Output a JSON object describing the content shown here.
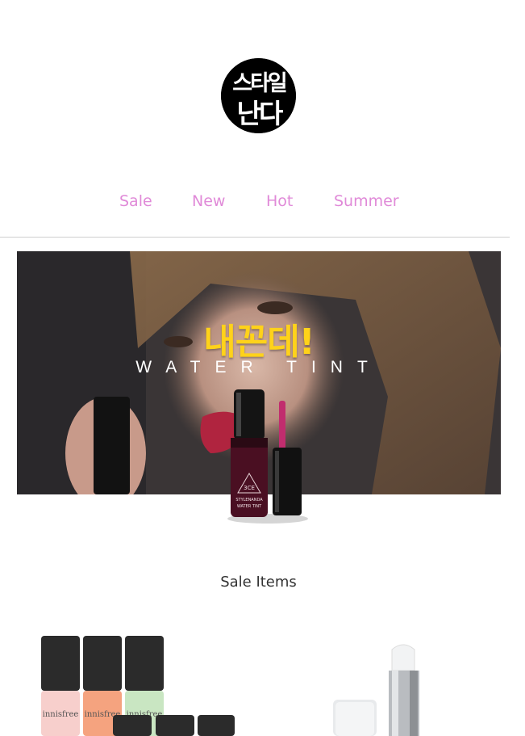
{
  "brand": {
    "logo_alt": "스타일난다",
    "logo_lines": [
      "스타일",
      "난다"
    ]
  },
  "nav": {
    "items": [
      {
        "label": "Sale"
      },
      {
        "label": "New"
      },
      {
        "label": "Hot"
      },
      {
        "label": "Summer"
      }
    ]
  },
  "banner": {
    "headline": "내꼰데!",
    "subtitle": "WATER TINT",
    "product_label_brand": "3CE",
    "product_label_line1": "STYLENANDA",
    "product_label_line2": "WATER TINT"
  },
  "sections": {
    "sale_title": "Sale Items"
  },
  "items": [
    {
      "brand_text": "innisfree",
      "image": "nail-polish-set-image"
    },
    {
      "image": "lip-balm-image"
    }
  ],
  "colors": {
    "nav_link": "#e08ad8",
    "headline": "#ffd21a",
    "divider": "#cfcfcf"
  }
}
